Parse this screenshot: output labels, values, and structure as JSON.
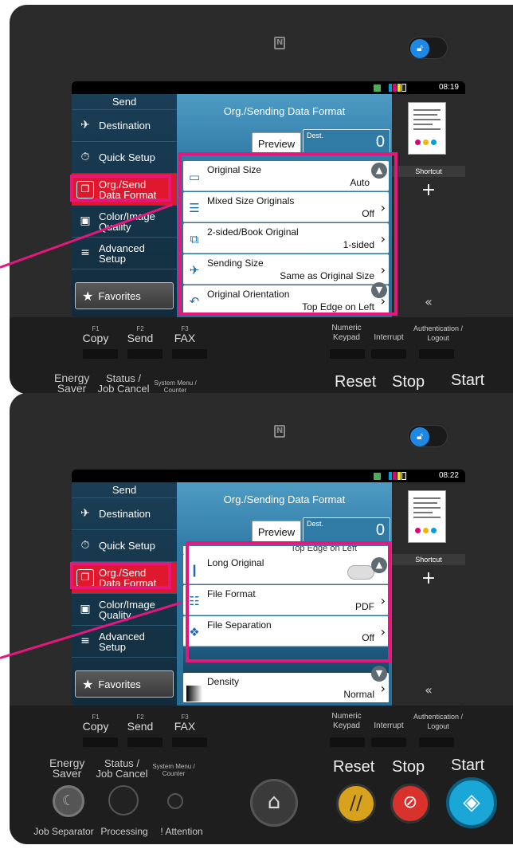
{
  "top_panel": {
    "status_time": "08:19",
    "left_menu": {
      "title": "Send",
      "items": [
        {
          "label": "Destination",
          "icon": "destination-icon"
        },
        {
          "label": "Quick Setup",
          "icon": "quick-setup-icon"
        },
        {
          "label": "Org./Send\nData Format",
          "icon": "org-send-icon",
          "active": true
        },
        {
          "label": "Color/Image\nQuality",
          "icon": "color-image-icon"
        },
        {
          "label": "Advanced\nSetup",
          "icon": "advanced-setup-icon"
        }
      ],
      "favorites": "Favorites"
    },
    "center": {
      "title": "Org./Sending Data Format",
      "preview": "Preview",
      "dest_label": "Dest.",
      "dest_count": "0",
      "rows": [
        {
          "label": "Original Size",
          "value": "Auto"
        },
        {
          "label": "Mixed Size Originals",
          "value": "Off"
        },
        {
          "label": "2-sided/Book Original",
          "value": "1-sided"
        },
        {
          "label": "Sending Size",
          "value": "Same as Original Size"
        },
        {
          "label": "Original Orientation",
          "value": "Top Edge on Left"
        }
      ]
    },
    "right": {
      "shortcut": "Shortcut",
      "add": "+",
      "collapse": "«"
    }
  },
  "bottom_panel": {
    "status_time": "08:22",
    "left_menu": {
      "title": "Send",
      "items": [
        {
          "label": "Destination"
        },
        {
          "label": "Quick Setup"
        },
        {
          "label": "Org./Send\nData Format",
          "active": true
        },
        {
          "label": "Color/Image\nQuality"
        },
        {
          "label": "Advanced\nSetup"
        }
      ],
      "favorites": "Favorites"
    },
    "center": {
      "title": "Org./Sending Data Format",
      "preview": "Preview",
      "dest_label": "Dest.",
      "dest_count": "0",
      "partial_top": "Top Edge on Left",
      "rows": [
        {
          "label": "Long Original",
          "value": ""
        },
        {
          "label": "File Format",
          "value": "PDF"
        },
        {
          "label": "File Separation",
          "value": "Off"
        }
      ],
      "density_label": "Density",
      "density_value": "Normal"
    },
    "right": {
      "shortcut": "Shortcut",
      "add": "+",
      "collapse": "«"
    }
  },
  "hardware": {
    "f1": "F1",
    "f1_label": "Copy",
    "f2": "F2",
    "f2_label": "Send",
    "f3": "F3",
    "f3_label": "FAX",
    "numeric_keypad": "Numeric\nKeypad",
    "interrupt": "Interrupt",
    "auth_logout": "Authentication /\nLogout",
    "energy_saver": "Energy\nSaver",
    "status_job_cancel": "Status /\nJob Cancel",
    "system_menu": "System Menu /\nCounter",
    "reset": "Reset",
    "stop": "Stop",
    "start": "Start",
    "job_separator": "Job Separator",
    "processing": "Processing",
    "attention": "! Attention"
  },
  "colors": {
    "callout": "#e5177c",
    "active_menu": "#e0182d",
    "start_button": "#1aa6d6",
    "stop_button": "#d8322c",
    "reset_button": "#d9a21c"
  }
}
